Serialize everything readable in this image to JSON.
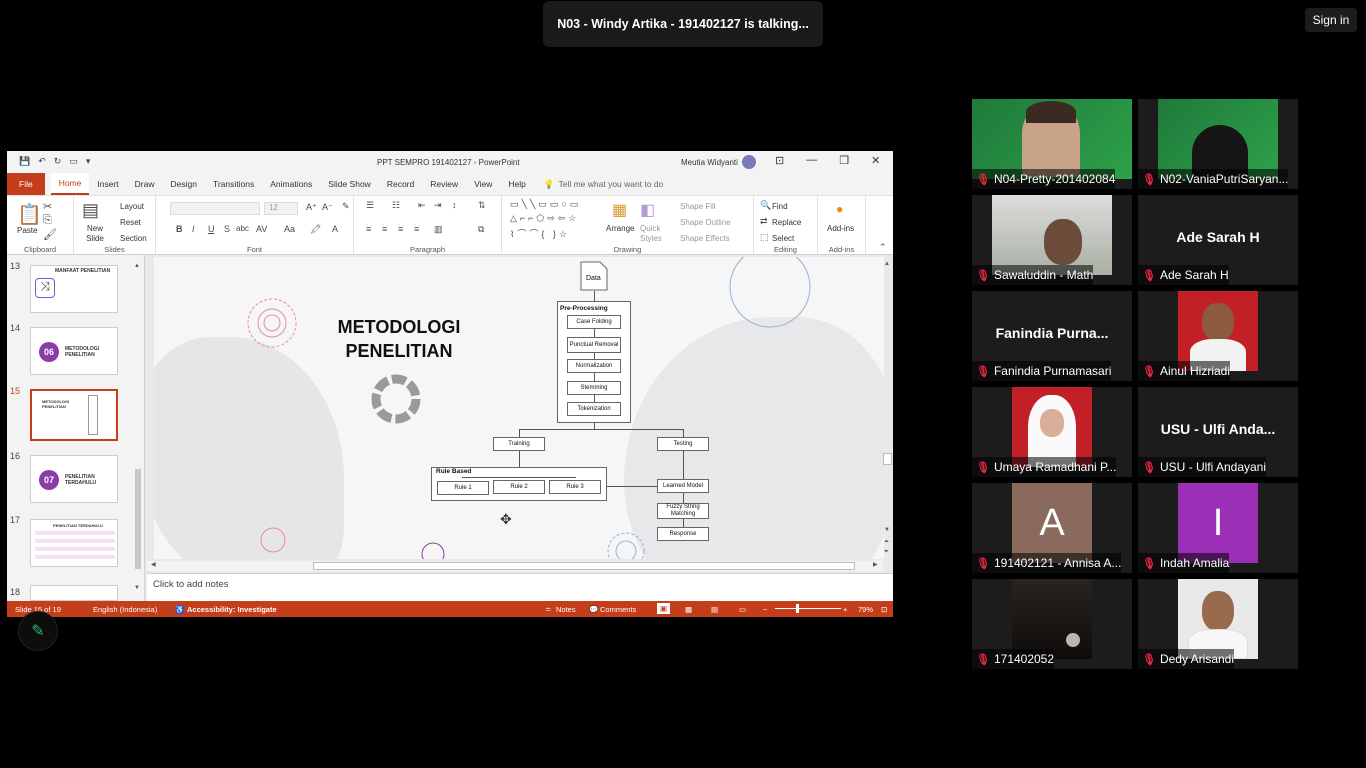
{
  "meeting": {
    "talking_banner": "N03 - Windy Artika - 191402127 is talking...",
    "sign_in": "Sign in"
  },
  "ppt": {
    "doc_title": "PPT SEMPRO 191402127  -  PowerPoint",
    "user_name": "Meutia Widyanti",
    "tabs": [
      "File",
      "Home",
      "Insert",
      "Draw",
      "Design",
      "Transitions",
      "Animations",
      "Slide Show",
      "Record",
      "Review",
      "View",
      "Help"
    ],
    "active_tab": "Home",
    "tell_me": "Tell me what you want to do",
    "ribbon": {
      "paste": "Paste",
      "new_slide": "New Slide",
      "layout": "Layout",
      "reset": "Reset",
      "section": "Section",
      "font_size": "12",
      "arrange": "Arrange",
      "quick_styles": "Quick Styles",
      "shape_fill": "Shape Fill",
      "shape_outline": "Shape Outline",
      "shape_effects": "Shape Effects",
      "find": "Find",
      "replace": "Replace",
      "select": "Select",
      "add_ins": "Add-ins",
      "groups": [
        "Clipboard",
        "Slides",
        "Font",
        "Paragraph",
        "Drawing",
        "Editing",
        "Add-ins"
      ]
    },
    "thumbnails": [
      {
        "num": "13",
        "title": "MANFAAT PENELITIAN"
      },
      {
        "num": "14",
        "badge": "06",
        "title": "METODOLOGI PENELITIAN"
      },
      {
        "num": "15",
        "title": "METODOLOGI PENELITIAN",
        "selected": true
      },
      {
        "num": "16",
        "badge": "07",
        "title": "PENELITIAN TERDAHULU"
      },
      {
        "num": "17",
        "title": "PENELITIAN TERDAHULU"
      },
      {
        "num": "18",
        "title": ""
      }
    ],
    "slide": {
      "title": "METODOLOGI PENELITIAN",
      "flow": {
        "data": "Data",
        "preprocessing": "Pre-Processing",
        "steps": [
          "Case Folding",
          "Punctual Removal",
          "Normalization",
          "Stemming",
          "Tokenization"
        ],
        "training": "Training",
        "testing": "Testing",
        "rule_based": "Rule Based",
        "rules": [
          "Rule 1",
          "Rule 2",
          "Rule 3"
        ],
        "learned_model": "Learned Model",
        "fuzzy": "Fuzzy String Matching",
        "response": "Response"
      }
    },
    "notes_placeholder": "Click to add notes",
    "status": {
      "slide": "Slide 15 of 19",
      "language": "English (Indonesia)",
      "accessibility": "Accessibility: Investigate",
      "notes": "Notes",
      "comments": "Comments",
      "zoom": "79%"
    }
  },
  "participants": [
    {
      "name": "N04-Pretty-201402084",
      "type": "video"
    },
    {
      "name": "N02-VaniaPutriSaryan...",
      "type": "video"
    },
    {
      "name": "Sawaluddin - Math",
      "type": "video"
    },
    {
      "name": "Ade Sarah H",
      "type": "name",
      "big": "Ade Sarah H"
    },
    {
      "name": "Fanindia Purnamasari",
      "type": "name",
      "big": "Fanindia  Purna..."
    },
    {
      "name": "Ainul Hizriadi",
      "type": "photo"
    },
    {
      "name": "Umaya Ramadhani P...",
      "type": "photo"
    },
    {
      "name": "USU - Ulfi Andayani",
      "type": "name",
      "big": "USU - Ulfi Anda..."
    },
    {
      "name": "191402121 - Annisa A...",
      "type": "initial",
      "initial": "A",
      "color": "#8b6a5e"
    },
    {
      "name": "Indah Amalia",
      "type": "initial",
      "initial": "I",
      "color": "#9b2fb5"
    },
    {
      "name": "171402052",
      "type": "video"
    },
    {
      "name": "Dedy Arisandi",
      "type": "photo"
    }
  ],
  "colors": {
    "ppt_accent": "#c43e1c",
    "mic_muted": "#e0283c",
    "zoom_bg": "#000000"
  }
}
